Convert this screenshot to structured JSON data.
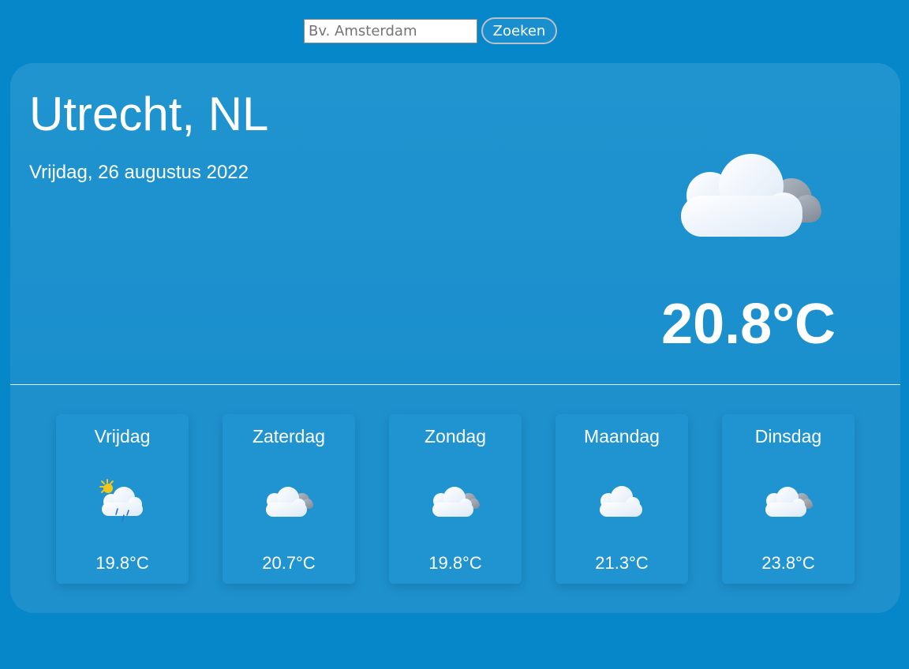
{
  "search": {
    "placeholder": "Bv. Amsterdam",
    "button_label": "Zoeken"
  },
  "current": {
    "city": "Utrecht, NL",
    "date": "Vrijdag, 26 augustus 2022",
    "temperature": "20.8°C",
    "icon": "cloudy-icon"
  },
  "forecast": [
    {
      "day": "Vrijdag",
      "temperature": "19.8°C",
      "icon": "sun-rain-cloud-icon"
    },
    {
      "day": "Zaterdag",
      "temperature": "20.7°C",
      "icon": "cloudy-icon"
    },
    {
      "day": "Zondag",
      "temperature": "19.8°C",
      "icon": "cloudy-icon"
    },
    {
      "day": "Maandag",
      "temperature": "21.3°C",
      "icon": "cloud-icon"
    },
    {
      "day": "Dinsdag",
      "temperature": "23.8°C",
      "icon": "cloudy-icon"
    }
  ],
  "colors": {
    "background": "#0687ca",
    "card": "#1e93cf",
    "text": "#ffffff"
  }
}
